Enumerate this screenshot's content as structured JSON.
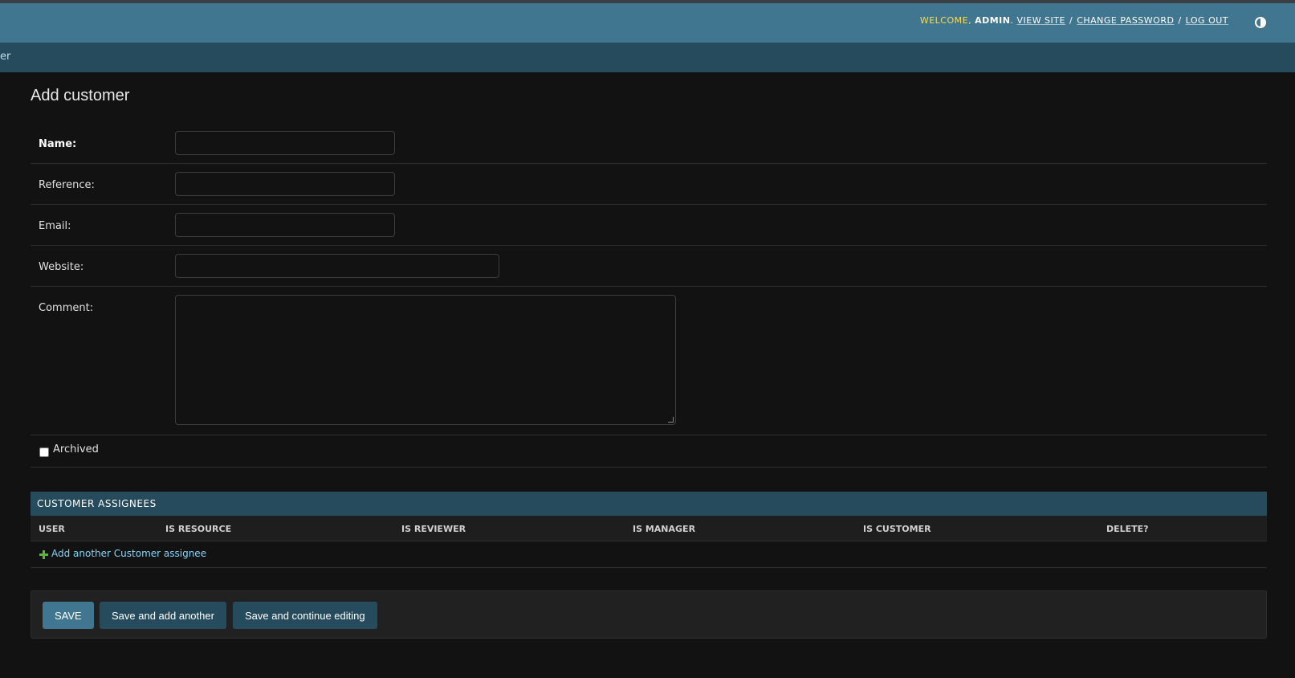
{
  "header": {
    "welcome": "WELCOME,",
    "username": "ADMIN",
    "view_site": "VIEW SITE",
    "change_password": "CHANGE PASSWORD",
    "log_out": "LOG OUT"
  },
  "breadcrumb": {
    "text": "er"
  },
  "page": {
    "title": "Add customer"
  },
  "form": {
    "name_label": "Name:",
    "name_value": "",
    "reference_label": "Reference:",
    "reference_value": "",
    "email_label": "Email:",
    "email_value": "",
    "website_label": "Website:",
    "website_value": "",
    "comment_label": "Comment:",
    "comment_value": "",
    "archived_label": "Archived",
    "archived_checked": false
  },
  "inline": {
    "title": "CUSTOMER ASSIGNEES",
    "columns": [
      "USER",
      "IS RESOURCE",
      "IS REVIEWER",
      "IS MANAGER",
      "IS CUSTOMER",
      "DELETE?"
    ],
    "add_link": "Add another Customer assignee"
  },
  "submit": {
    "save": "SAVE",
    "save_add": "Save and add another",
    "save_continue": "Save and continue editing"
  },
  "colors": {
    "header": "#417690",
    "breadcrumb_bar": "#264b5d",
    "background": "#121212",
    "link": "#81d4fa",
    "add_icon": "#5bb43a"
  }
}
